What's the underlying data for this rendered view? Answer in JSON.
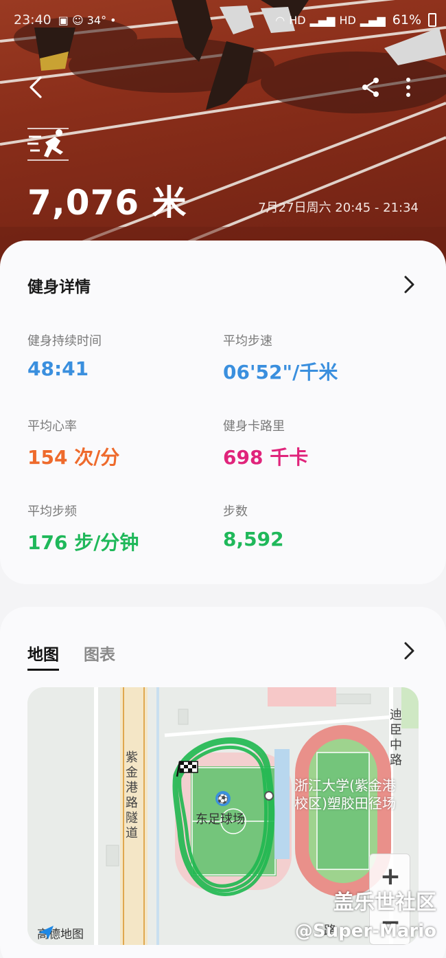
{
  "status_bar": {
    "time": "23:40",
    "temp": "34°",
    "network_1": "HD",
    "network_2": "HD",
    "battery": "61%"
  },
  "header": {
    "distance": "7,076 米",
    "date_range": "7月27日周六 20:45 - 21:34"
  },
  "details": {
    "title": "健身详情",
    "metrics": [
      {
        "label": "健身持续时间",
        "value": "48:41",
        "color": "#3a8fde"
      },
      {
        "label": "平均步速",
        "value": "06'52\"/千米",
        "color": "#3a8fde"
      },
      {
        "label": "平均心率",
        "value": "154 次/分",
        "color": "#ee6a2c"
      },
      {
        "label": "健身卡路里",
        "value": "698 千卡",
        "color": "#e0247b"
      },
      {
        "label": "平均步频",
        "value": "176 步/分钟",
        "color": "#1fb85a"
      },
      {
        "label": "步数",
        "value": "8,592",
        "color": "#1fb85a"
      }
    ]
  },
  "map_section": {
    "tabs": [
      "地图",
      "图表"
    ],
    "active_tab": "地图",
    "labels": {
      "road_1": "紫金港路隧道",
      "road_2": "迪臣中路",
      "stadium_1": "东足球场",
      "stadium_2": "浙江大学(紫金港校区)塑胶田径场",
      "road_3": "路"
    },
    "logo": "高德地图",
    "zoom_in": "+",
    "zoom_out": "−"
  },
  "watermark": {
    "line1": "盖乐世社区",
    "line2": "@Super-Mario"
  }
}
